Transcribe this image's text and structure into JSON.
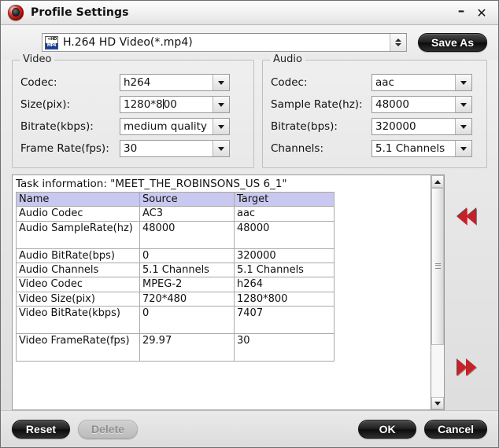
{
  "window": {
    "title": "Profile Settings",
    "app_icon": "disc-app-icon",
    "minimize_label": "–",
    "close_label": "✕"
  },
  "topbar": {
    "profile_icon": "hd-mp4-format-icon",
    "profile_value": "H.264 HD Video(*.mp4)",
    "spinner_icon": "up-down-spinner-icon",
    "save_as_label": "Save As"
  },
  "video": {
    "title": "Video",
    "fields": [
      {
        "label": "Codec:",
        "value": "h264"
      },
      {
        "label": "Size(pix):",
        "value": "1280*800",
        "caret_after": "1280*8"
      },
      {
        "label": "Bitrate(kbps):",
        "value": "medium quality"
      },
      {
        "label": "Frame Rate(fps):",
        "value": "30"
      }
    ]
  },
  "audio": {
    "title": "Audio",
    "fields": [
      {
        "label": "Codec:",
        "value": "aac"
      },
      {
        "label": "Sample Rate(hz):",
        "value": "48000"
      },
      {
        "label": "Bitrate(bps):",
        "value": "320000"
      },
      {
        "label": "Channels:",
        "value": "5.1 Channels"
      }
    ]
  },
  "task": {
    "title": "Task information: \"MEET_THE_ROBINSONS_US 6_1\"",
    "columns": [
      "Name",
      "Source",
      "Target"
    ],
    "rows": [
      {
        "name": "Audio Codec",
        "source": "AC3",
        "target": "aac",
        "tall": false
      },
      {
        "name": "Audio SampleRate(hz)",
        "source": "48000",
        "target": "48000",
        "tall": true
      },
      {
        "name": "Audio BitRate(bps)",
        "source": "0",
        "target": "320000",
        "tall": false
      },
      {
        "name": "Audio Channels",
        "source": "5.1 Channels",
        "target": "5.1 Channels",
        "tall": false
      },
      {
        "name": "Video Codec",
        "source": "MPEG-2",
        "target": "h264",
        "tall": false
      },
      {
        "name": "Video Size(pix)",
        "source": "720*480",
        "target": "1280*800",
        "tall": false
      },
      {
        "name": "Video BitRate(kbps)",
        "source": "0",
        "target": "7407",
        "tall": true
      },
      {
        "name": "Video FrameRate(fps)",
        "source": "29.97",
        "target": "30",
        "tall": true
      }
    ],
    "scrollbar": {
      "up_icon": "scroll-up-arrow-icon",
      "down_icon": "scroll-down-arrow-icon",
      "thumb_grip_icon": "scrollbar-grip-icon"
    }
  },
  "nav": {
    "back_icon": "double-left-arrow-icon",
    "forward_icon": "double-right-arrow-icon",
    "arrow_color": "#c0232a"
  },
  "footer": {
    "reset_label": "Reset",
    "delete_label": "Delete",
    "ok_label": "OK",
    "cancel_label": "Cancel"
  },
  "colors": {
    "table_header": "#c8c8f0",
    "accent_red": "#c0232a",
    "window_bg": "#ededed"
  }
}
